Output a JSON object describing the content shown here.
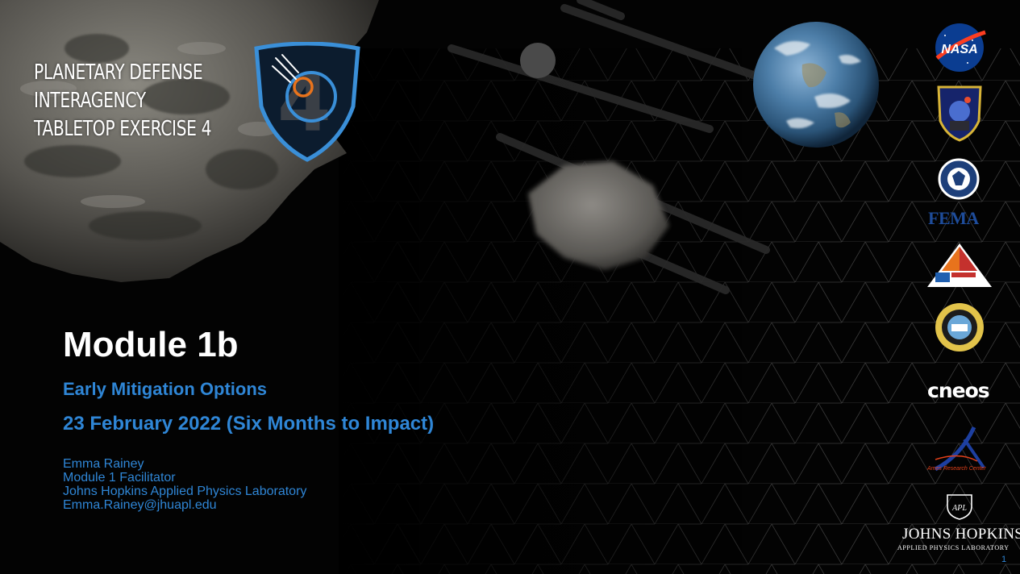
{
  "exercise": {
    "title_lines": [
      "PLANETARY DEFENSE",
      "INTERAGENCY",
      "TABLETOP EXERCISE 4"
    ]
  },
  "module": {
    "title": "Module 1b",
    "subtitle": "Early Mitigation Options",
    "date_line": "23 February 2022 (Six Months to Impact)"
  },
  "presenter": {
    "name": "Emma Rainey",
    "role": "Module 1 Facilitator",
    "organization": "Johns Hopkins Applied Physics Laboratory",
    "email": "Emma.Rainey@jhuapl.edu"
  },
  "logos": {
    "nasa_text": "NASA",
    "fema_text": "FEMA",
    "cneos_text": "cneos",
    "ames_text": "Ames Research Center",
    "apl_text": "APL",
    "jh_name": "JOHNS HOPKINS",
    "jh_sub": "APPLIED PHYSICS LABORATORY"
  },
  "page_number": "1",
  "colors": {
    "accent_blue": "#2f86d6",
    "background": "#020202",
    "badge_border": "#3a8fd8",
    "badge_orange": "#e8731c"
  },
  "icons": [
    "badge-icon",
    "nasa-logo",
    "planetary-defense-logo",
    "dhs-seal",
    "fema-logo",
    "nc-emergency-logo",
    "county-seal",
    "cneos-logo",
    "ames-logo",
    "apl-logo"
  ]
}
